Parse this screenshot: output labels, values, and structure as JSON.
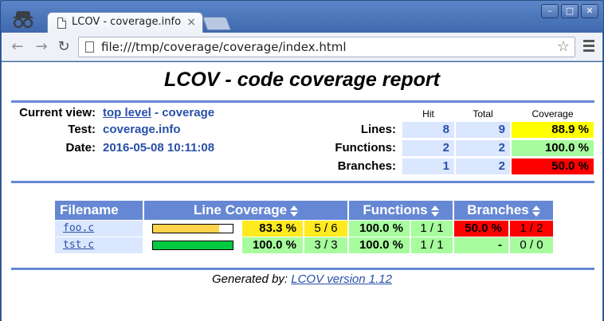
{
  "browser": {
    "tab_title": "LCOV - coverage.info",
    "url": "file:///tmp/coverage/coverage/index.html"
  },
  "page": {
    "title": "LCOV - code coverage report",
    "current_view_label": "Current view:",
    "current_view_link": "top level",
    "current_view_sep": " - ",
    "current_view_name": "coverage",
    "test_label": "Test:",
    "test_value": "coverage.info",
    "date_label": "Date:",
    "date_value": "2016-05-08 10:11:08"
  },
  "summary": {
    "headers": {
      "hit": "Hit",
      "total": "Total",
      "coverage": "Coverage"
    },
    "rows": [
      {
        "label": "Lines:",
        "hit": "8",
        "total": "9",
        "coverage": "88.9 %",
        "color": "#ffff00"
      },
      {
        "label": "Functions:",
        "hit": "2",
        "total": "2",
        "coverage": "100.0 %",
        "color": "#a7fc9d"
      },
      {
        "label": "Branches:",
        "hit": "1",
        "total": "2",
        "coverage": "50.0 %",
        "color": "#ff0000"
      }
    ]
  },
  "table": {
    "headers": {
      "filename": "Filename",
      "line_coverage": "Line Coverage",
      "functions": "Functions",
      "branches": "Branches"
    },
    "rows": [
      {
        "file": "foo.c",
        "line_fraction": 0.833,
        "bar_color": "#ffd34a",
        "line_pct": "83.3 %",
        "line_ratio": "5 / 6",
        "line_color": "#ffea20",
        "func_pct": "100.0 %",
        "func_ratio": "1 / 1",
        "func_color": "#a7fc9d",
        "branch_pct": "50.0 %",
        "branch_ratio": "1 / 2",
        "branch_color": "#ff0000"
      },
      {
        "file": "tst.c",
        "line_fraction": 1.0,
        "bar_color": "#00cb40",
        "line_pct": "100.0 %",
        "line_ratio": "3 / 3",
        "line_color": "#a7fc9d",
        "func_pct": "100.0 %",
        "func_ratio": "1 / 1",
        "func_color": "#a7fc9d",
        "branch_pct": "-",
        "branch_ratio": "0 / 0",
        "branch_color": "#a7fc9d"
      }
    ]
  },
  "footer": {
    "prefix": "Generated by: ",
    "link": "LCOV version 1.12"
  }
}
